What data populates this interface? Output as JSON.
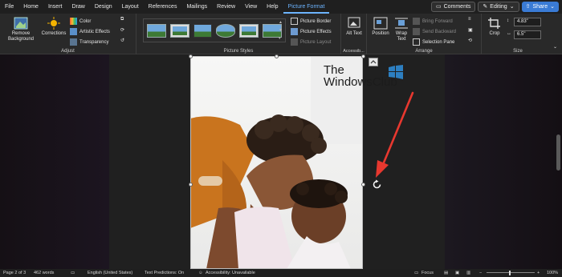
{
  "menu": {
    "tabs": [
      "File",
      "Home",
      "Insert",
      "Draw",
      "Design",
      "Layout",
      "References",
      "Mailings",
      "Review",
      "View",
      "Help",
      "Picture Format"
    ],
    "active_tab": "Picture Format",
    "comments": "Comments",
    "editing": "Editing",
    "share": "Share"
  },
  "ribbon": {
    "adjust": {
      "label": "Adjust",
      "remove_background": "Remove Background",
      "corrections": "Corrections",
      "color": "Color",
      "artistic_effects": "Artistic Effects",
      "transparency": "Transparency"
    },
    "picture_styles": {
      "label": "Picture Styles",
      "picture_border": "Picture Border",
      "picture_effects": "Picture Effects",
      "picture_layout": "Picture Layout"
    },
    "accessibility": {
      "label": "Accessib...",
      "alt_text": "Alt Text"
    },
    "arrange": {
      "label": "Arrange",
      "position": "Position",
      "wrap_text": "Wrap Text",
      "bring_forward": "Bring Forward",
      "send_backward": "Send Backward",
      "selection_pane": "Selection Pane"
    },
    "size": {
      "label": "Size",
      "crop": "Crop",
      "height": "4.83\"",
      "width": "6.5\""
    }
  },
  "watermark": {
    "line1": "The",
    "line2": "WindowsClub"
  },
  "status": {
    "page": "Page 2 of 3",
    "words": "462 words",
    "language": "English (United States)",
    "predictions": "Text Predictions: On",
    "accessibility": "Accessibility: Unavailable",
    "focus": "Focus",
    "zoom": "100%"
  },
  "colors": {
    "accent": "#6cb4ff",
    "share": "#3a7bd5",
    "arrow": "#e8382f",
    "orange_top": "#c9741e"
  }
}
